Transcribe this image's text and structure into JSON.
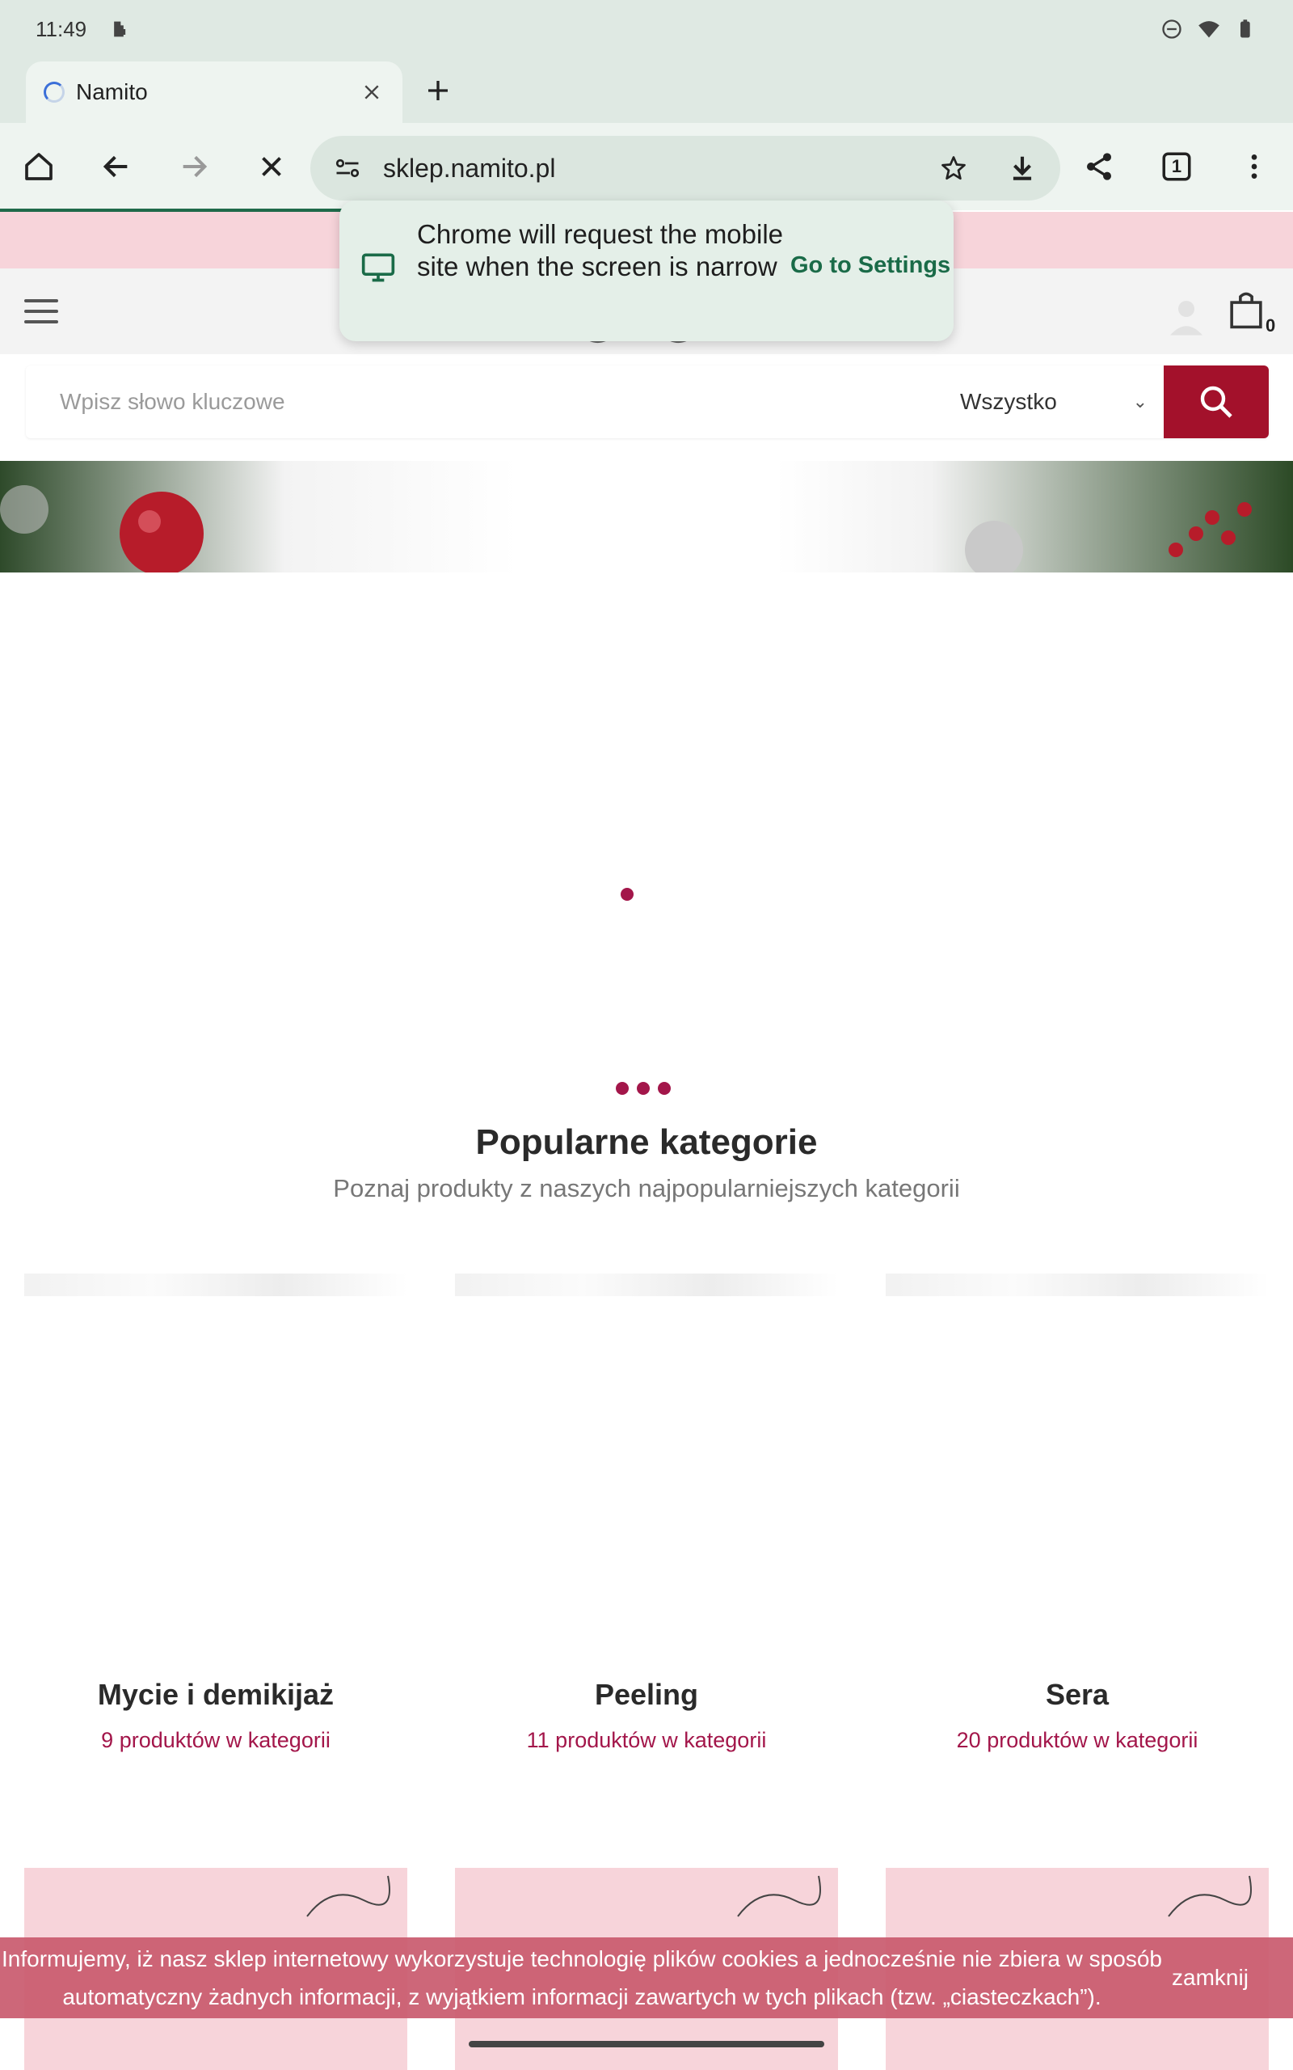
{
  "status_bar": {
    "time": "11:49"
  },
  "browser": {
    "tab_title": "Namito",
    "url": "sklep.namito.pl",
    "tab_count": "1"
  },
  "tooltip": {
    "message": "Chrome will request the mobile site when the screen is narrow",
    "action": "Go to Settings"
  },
  "header": {
    "cart_count": "0"
  },
  "search": {
    "placeholder": "Wpisz słowo kluczowe",
    "category": "Wszystko"
  },
  "popular": {
    "title": "Popularne kategorie",
    "subtitle": "Poznaj produkty z naszych najpopularniejszych kategorii",
    "categories": [
      {
        "name": "Mycie i demikijaż",
        "count": "9 produktów w kategorii"
      },
      {
        "name": "Peeling",
        "count": "11 produktów w kategorii"
      },
      {
        "name": "Sera",
        "count": "20 produktów w kategorii"
      }
    ]
  },
  "cookie": {
    "text": "Informujemy, iż nasz sklep internetowy wykorzystuje technologię plików cookies a jednocześnie nie zbiera w sposób automatyczny żadnych informacji, z wyjątkiem informacji zawartych w tych plikach (tzw. „ciasteczkach”).",
    "close": "zamknij"
  },
  "colors": {
    "accent": "#a3112b",
    "chrome_bg": "#dfe9e3",
    "promo_pink": "#f7d4da",
    "link_green": "#1a6b48"
  }
}
